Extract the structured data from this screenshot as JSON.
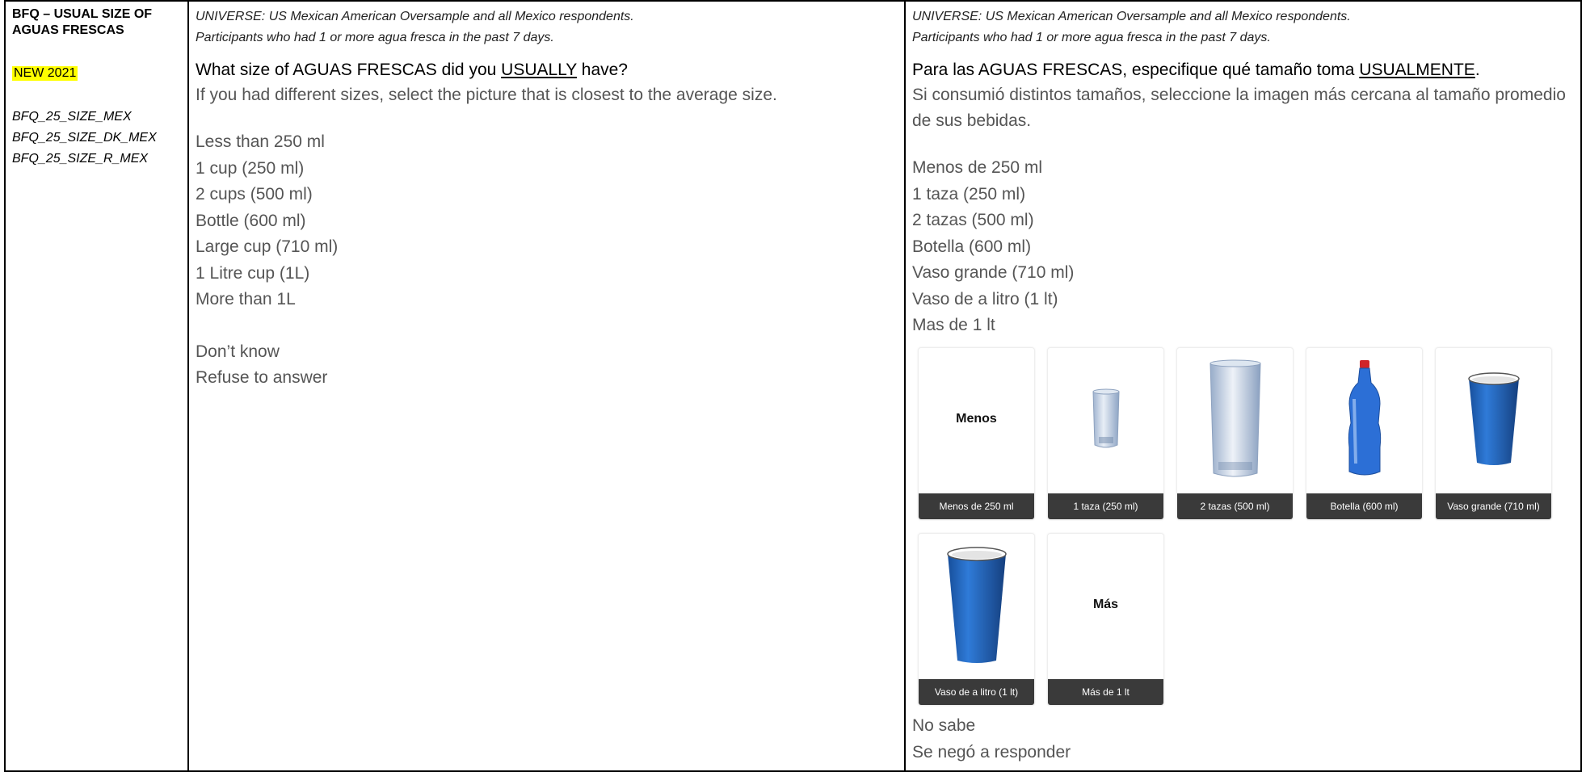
{
  "id_column": {
    "title": "BFQ – USUAL SIZE OF AGUAS FRESCAS",
    "new_tag": "NEW 2021",
    "variables": [
      "BFQ_25_SIZE_MEX",
      "BFQ_25_SIZE_DK_MEX",
      "BFQ_25_SIZE_R_MEX"
    ]
  },
  "english": {
    "universe_line1": "UNIVERSE: US Mexican American Oversample and all Mexico respondents.",
    "universe_line2": "Participants who had 1 or more agua fresca in the past 7 days.",
    "question_pre": "What size of AGUAS FRESCAS did you ",
    "question_emph": "USUALLY",
    "question_post": " have?",
    "instruction": "If you had different sizes, select the picture that is closest to the average size.",
    "options": [
      "Less than 250 ml",
      "1 cup (250 ml)",
      "2 cups (500 ml)",
      "Bottle (600 ml)",
      "Large cup (710 ml)",
      "1 Litre cup (1L)",
      "More than 1L"
    ],
    "special_options": [
      "Don’t know",
      "Refuse to answer"
    ]
  },
  "spanish": {
    "universe_line1": "UNIVERSE: US Mexican American Oversample and all Mexico respondents.",
    "universe_line2": "Participants who had 1 or more agua fresca in the past 7 days.",
    "question_pre": "Para las AGUAS FRESCAS, especifique qué tamaño toma ",
    "question_emph": "USUALMENTE",
    "question_post": ".",
    "instruction": "Si consumió distintos tamaños, seleccione la imagen más cercana al tamaño promedio de sus bebidas.",
    "options": [
      "Menos de 250 ml",
      "1 taza (250 ml)",
      "2 tazas (500 ml)",
      "Botella (600 ml)",
      "Vaso grande (710 ml)",
      "Vaso de a litro (1 lt)",
      "Mas de 1 lt"
    ],
    "tiles": [
      {
        "caption": "Menos de 250 ml",
        "word": "Menos",
        "icon": "text-menos"
      },
      {
        "caption": "1 taza (250 ml)",
        "icon": "small-glass-icon"
      },
      {
        "caption": "2 tazas (500 ml)",
        "icon": "tall-glass-icon"
      },
      {
        "caption": "Botella (600 ml)",
        "icon": "bottle-icon"
      },
      {
        "caption": "Vaso grande (710 ml)",
        "icon": "blue-cup-icon"
      },
      {
        "caption": "Vaso de a litro (1 lt)",
        "icon": "large-blue-cup-icon"
      },
      {
        "caption": "Más de 1 lt",
        "word": "Más",
        "icon": "text-mas"
      }
    ],
    "special_options": [
      "No sabe",
      "Se negó a responder"
    ]
  },
  "colors": {
    "highlight": "#ffff00",
    "caption_bg": "#3a3a3a",
    "cup_blue": "#1f63b8"
  }
}
